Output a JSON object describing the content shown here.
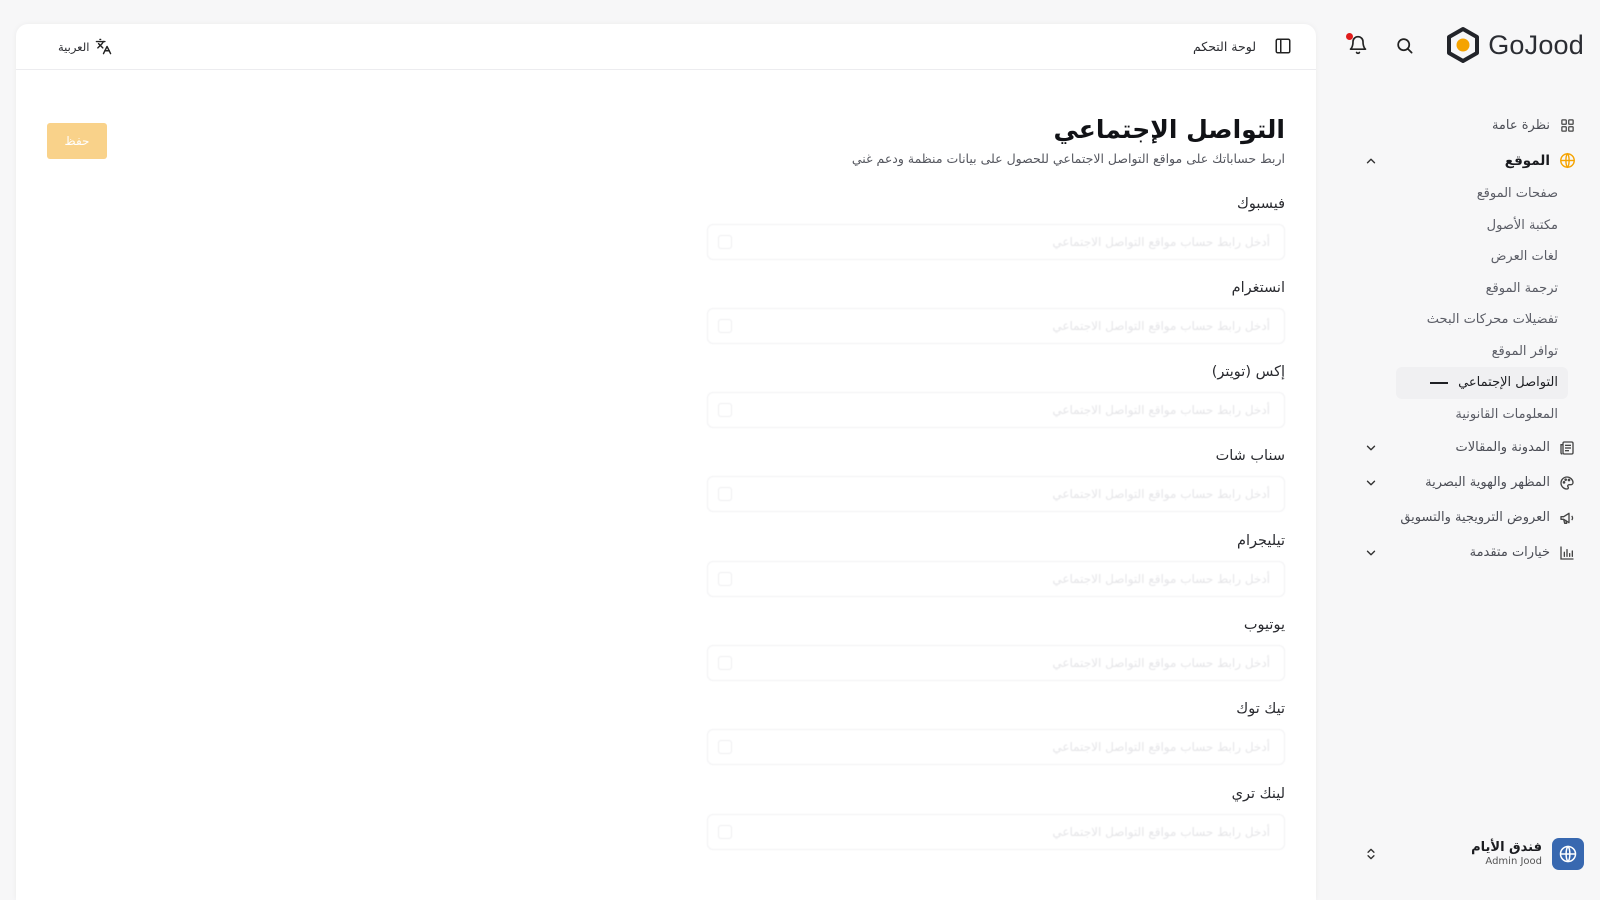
{
  "brand": {
    "name": "GoJood"
  },
  "colors": {
    "accent": "#f5a300",
    "save_button": "#f9d28a",
    "avatar": "#3868b0",
    "notification_dot": "#e01b1b"
  },
  "sidebar": {
    "overview": "نظرة عامة",
    "site": {
      "label": "الموقع",
      "items": [
        "صفحات الموقع",
        "مكتبة الأصول",
        "لغات العرض",
        "ترجمة الموقع",
        "تفضيلات محركات البحث",
        "توافر الموقع",
        "التواصل الإجتماعي",
        "المعلومات القانونية"
      ]
    },
    "blog": "المدونة والمقالات",
    "appearance": "المظهر والهوية البصرية",
    "promotions": "العروض الترويجية والتسويق",
    "advanced": "خيارات متقدمة"
  },
  "account": {
    "name": "فندق الأيام",
    "role": "Admin Jood"
  },
  "topbar": {
    "breadcrumb": "لوحة التحكم",
    "language": "العربية"
  },
  "page": {
    "title": "التواصل الإجتماعي",
    "subtitle": "اربط حساباتك على مواقع التواصل الاجتماعي للحصول على بيانات منظمة ودعم غني",
    "save_label": "حفظ"
  },
  "fields": [
    {
      "label": "فيسبوك",
      "placeholder": "أدخل رابط حساب مواقع التواصل الاجتماعي"
    },
    {
      "label": "انستغرام",
      "placeholder": "أدخل رابط حساب مواقع التواصل الاجتماعي"
    },
    {
      "label": "إكس (تويتر)",
      "placeholder": "أدخل رابط حساب مواقع التواصل الاجتماعي"
    },
    {
      "label": "سناب شات",
      "placeholder": "أدخل رابط حساب مواقع التواصل الاجتماعي"
    },
    {
      "label": "تيليجرام",
      "placeholder": "أدخل رابط حساب مواقع التواصل الاجتماعي"
    },
    {
      "label": "يوتيوب",
      "placeholder": "أدخل رابط حساب مواقع التواصل الاجتماعي"
    },
    {
      "label": "تيك توك",
      "placeholder": "أدخل رابط حساب مواقع التواصل الاجتماعي"
    },
    {
      "label": "لينك تري",
      "placeholder": "أدخل رابط حساب مواقع التواصل الاجتماعي"
    }
  ]
}
